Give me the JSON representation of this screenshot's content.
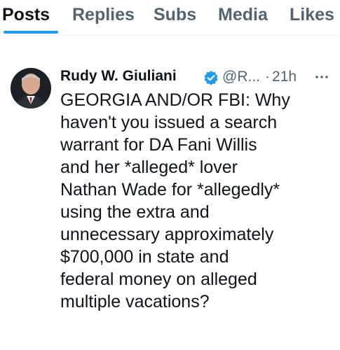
{
  "tabs": [
    {
      "label": "Posts",
      "active": true
    },
    {
      "label": "Replies",
      "active": false
    },
    {
      "label": "Subs",
      "active": false
    },
    {
      "label": "Media",
      "active": false
    },
    {
      "label": "Likes",
      "active": false
    }
  ],
  "post": {
    "author_name": "Rudy W. Giuliani",
    "verified": true,
    "handle": "@R...",
    "separator": "·",
    "timestamp": "21h",
    "more_icon": "ellipsis-icon",
    "text": "GEORGIA AND/OR FBI: Why\nhaven't you issued a search\nwarrant for DA Fani Willis\nand her *alleged* lover\nNathan Wade for *allegedly*\nusing the extra and\nunnecessary approximately\n$700,000 in state and\nfederal money on alleged\nmultiple vacations?"
  },
  "colors": {
    "accent": "#1d9bf0",
    "text_primary": "#0f1419",
    "text_secondary": "#536471"
  }
}
